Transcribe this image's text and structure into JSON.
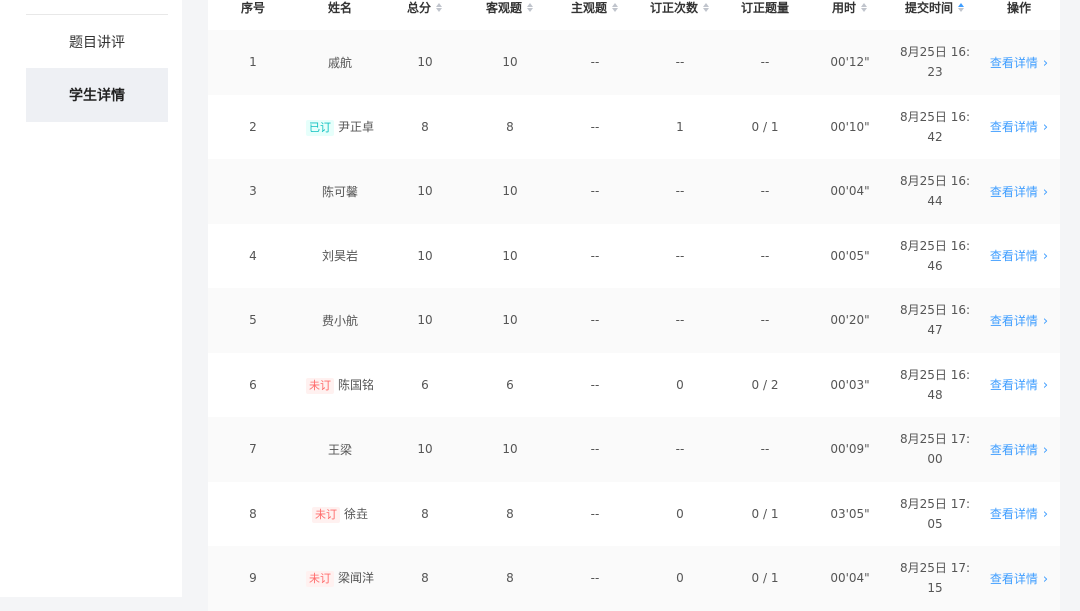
{
  "sidebar": {
    "items": [
      {
        "label": "题目讲评",
        "active": false
      },
      {
        "label": "学生详情",
        "active": true
      }
    ]
  },
  "table": {
    "headers": {
      "index": "序号",
      "name": "姓名",
      "total": "总分",
      "objective": "客观题",
      "subjective": "主观题",
      "correction_count": "订正次数",
      "correction_questions": "订正题量",
      "duration": "用时",
      "submit_time": "提交时间",
      "action": "操作"
    },
    "detail_label": "查看详情",
    "rows": [
      {
        "index": "1",
        "badge": "",
        "name": "戚航",
        "total": "10",
        "objective": "10",
        "subjective": "--",
        "correction_count": "--",
        "correction_questions": "--",
        "duration": "00'12\"",
        "submit_date": "8月25日 16:",
        "submit_min": "23"
      },
      {
        "index": "2",
        "badge": "已订",
        "name": "尹正卓",
        "total": "8",
        "objective": "8",
        "subjective": "--",
        "correction_count": "1",
        "correction_questions": "0 / 1",
        "duration": "00'10\"",
        "submit_date": "8月25日 16:",
        "submit_min": "42"
      },
      {
        "index": "3",
        "badge": "",
        "name": "陈可馨",
        "total": "10",
        "objective": "10",
        "subjective": "--",
        "correction_count": "--",
        "correction_questions": "--",
        "duration": "00'04\"",
        "submit_date": "8月25日 16:",
        "submit_min": "44"
      },
      {
        "index": "4",
        "badge": "",
        "name": "刘昊岩",
        "total": "10",
        "objective": "10",
        "subjective": "--",
        "correction_count": "--",
        "correction_questions": "--",
        "duration": "00'05\"",
        "submit_date": "8月25日 16:",
        "submit_min": "46"
      },
      {
        "index": "5",
        "badge": "",
        "name": "费小航",
        "total": "10",
        "objective": "10",
        "subjective": "--",
        "correction_count": "--",
        "correction_questions": "--",
        "duration": "00'20\"",
        "submit_date": "8月25日 16:",
        "submit_min": "47"
      },
      {
        "index": "6",
        "badge": "未订",
        "name": "陈国铭",
        "total": "6",
        "objective": "6",
        "subjective": "--",
        "correction_count": "0",
        "correction_questions": "0 / 2",
        "duration": "00'03\"",
        "submit_date": "8月25日 16:",
        "submit_min": "48"
      },
      {
        "index": "7",
        "badge": "",
        "name": "王梁",
        "total": "10",
        "objective": "10",
        "subjective": "--",
        "correction_count": "--",
        "correction_questions": "--",
        "duration": "00'09\"",
        "submit_date": "8月25日 17:",
        "submit_min": "00"
      },
      {
        "index": "8",
        "badge": "未订",
        "name": "徐垚",
        "total": "8",
        "objective": "8",
        "subjective": "--",
        "correction_count": "0",
        "correction_questions": "0 / 1",
        "duration": "03'05\"",
        "submit_date": "8月25日 17:",
        "submit_min": "05"
      },
      {
        "index": "9",
        "badge": "未订",
        "name": "梁闻洋",
        "total": "8",
        "objective": "8",
        "subjective": "--",
        "correction_count": "0",
        "correction_questions": "0 / 1",
        "duration": "00'04\"",
        "submit_date": "8月25日 17:",
        "submit_min": "15"
      }
    ]
  },
  "colors": {
    "accent": "#409eff",
    "badge_done": "#13c2c2",
    "badge_not": "#ff6b6b"
  }
}
